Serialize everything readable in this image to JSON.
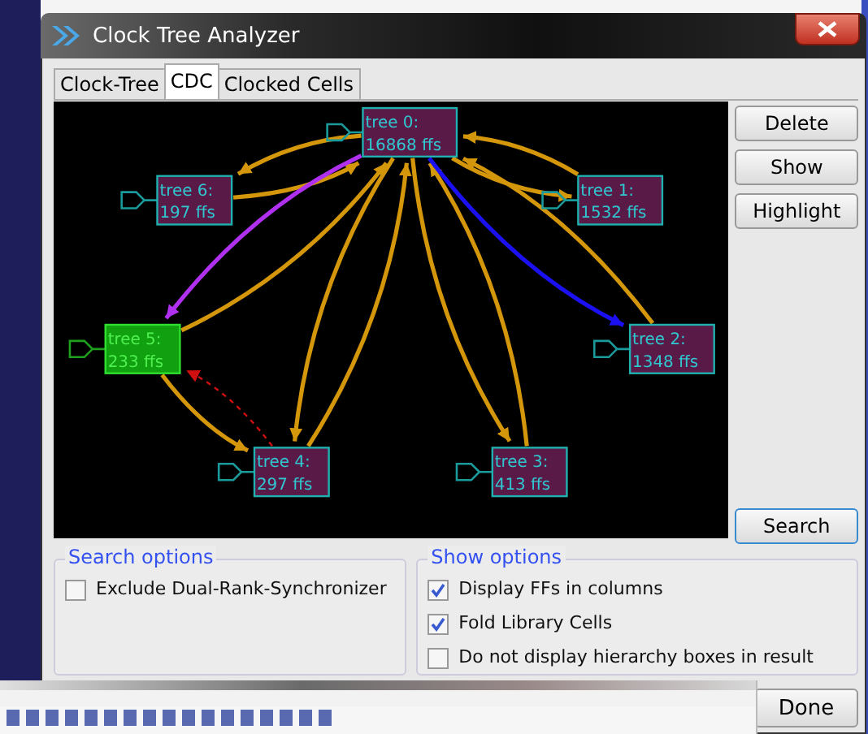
{
  "window": {
    "title": "Clock Tree Analyzer"
  },
  "tabs": [
    {
      "label": "Clock-Tree",
      "selected": false
    },
    {
      "label": "CDC",
      "selected": true
    },
    {
      "label": "Clocked Cells",
      "selected": false
    }
  ],
  "graph": {
    "nodes": [
      {
        "name": "tree 0:",
        "count": "16868 ffs",
        "selected": false
      },
      {
        "name": "tree 6:",
        "count": "197 ffs",
        "selected": false
      },
      {
        "name": "tree 1:",
        "count": "1532 ffs",
        "selected": false
      },
      {
        "name": "tree 5:",
        "count": "233 ffs",
        "selected": true
      },
      {
        "name": "tree 2:",
        "count": "1348 ffs",
        "selected": false
      },
      {
        "name": "tree 4:",
        "count": "297 ffs",
        "selected": false
      },
      {
        "name": "tree 3:",
        "count": "413 ffs",
        "selected": false
      }
    ],
    "edges": [
      {
        "kind": "solid",
        "color": "#d4960a"
      },
      {
        "kind": "solid",
        "color": "#d4960a"
      },
      {
        "kind": "solid",
        "color": "#d4960a"
      },
      {
        "kind": "solid",
        "color": "#d4960a"
      },
      {
        "kind": "solid",
        "color": "#b030f0"
      },
      {
        "kind": "solid",
        "color": "#d4960a"
      },
      {
        "kind": "solid",
        "color": "#d4960a"
      },
      {
        "kind": "solid",
        "color": "#d4960a"
      },
      {
        "kind": "solid",
        "color": "#d4960a"
      },
      {
        "kind": "solid",
        "color": "#d4960a"
      },
      {
        "kind": "solid",
        "color": "#1a10f0"
      },
      {
        "kind": "solid",
        "color": "#d4960a"
      },
      {
        "kind": "solid",
        "color": "#d4960a"
      },
      {
        "kind": "dashed",
        "color": "#d01010"
      }
    ]
  },
  "side_buttons": [
    "Delete",
    "Show",
    "Highlight"
  ],
  "search_button": "Search",
  "search_options": {
    "title": "Search options",
    "items": [
      {
        "label": "Exclude Dual-Rank-Synchronizer",
        "checked": false
      }
    ]
  },
  "show_options": {
    "title": "Show options",
    "items": [
      {
        "label": "Display FFs in columns",
        "checked": true
      },
      {
        "label": "Fold Library Cells",
        "checked": true
      },
      {
        "label": "Do not display hierarchy boxes in result",
        "checked": false
      }
    ]
  },
  "done_button": "Done"
}
